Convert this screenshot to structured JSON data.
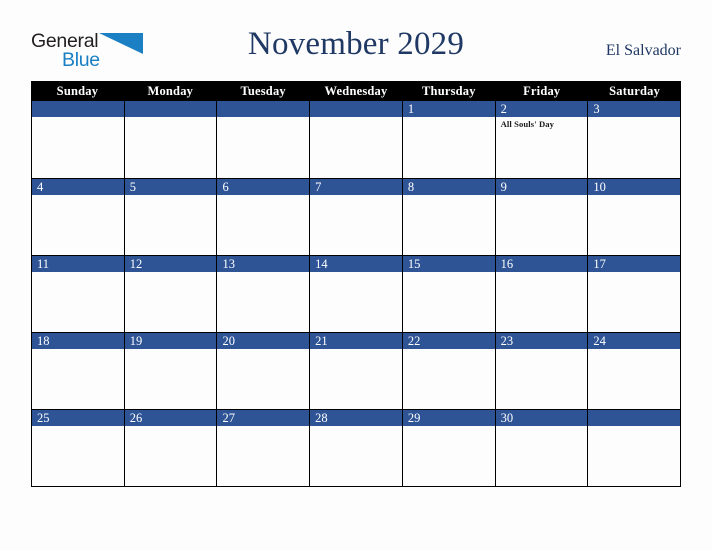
{
  "brand": {
    "name_part1": "General",
    "name_part2": "Blue",
    "triangle_color": "#1b7fc4",
    "text_color": "#231f20"
  },
  "header": {
    "title": "November 2029",
    "region": "El Salvador",
    "title_color": "#1f3864"
  },
  "calendar": {
    "month": "November",
    "year": "2029",
    "accent_color": "#2e5496",
    "header_bg": "#000000",
    "weekday_headers": [
      "Sunday",
      "Monday",
      "Tuesday",
      "Wednesday",
      "Thursday",
      "Friday",
      "Saturday"
    ],
    "weeks": [
      [
        {
          "date": "",
          "events": []
        },
        {
          "date": "",
          "events": []
        },
        {
          "date": "",
          "events": []
        },
        {
          "date": "",
          "events": []
        },
        {
          "date": "1",
          "events": []
        },
        {
          "date": "2",
          "events": [
            "All Souls' Day"
          ]
        },
        {
          "date": "3",
          "events": []
        }
      ],
      [
        {
          "date": "4",
          "events": []
        },
        {
          "date": "5",
          "events": []
        },
        {
          "date": "6",
          "events": []
        },
        {
          "date": "7",
          "events": []
        },
        {
          "date": "8",
          "events": []
        },
        {
          "date": "9",
          "events": []
        },
        {
          "date": "10",
          "events": []
        }
      ],
      [
        {
          "date": "11",
          "events": []
        },
        {
          "date": "12",
          "events": []
        },
        {
          "date": "13",
          "events": []
        },
        {
          "date": "14",
          "events": []
        },
        {
          "date": "15",
          "events": []
        },
        {
          "date": "16",
          "events": []
        },
        {
          "date": "17",
          "events": []
        }
      ],
      [
        {
          "date": "18",
          "events": []
        },
        {
          "date": "19",
          "events": []
        },
        {
          "date": "20",
          "events": []
        },
        {
          "date": "21",
          "events": []
        },
        {
          "date": "22",
          "events": []
        },
        {
          "date": "23",
          "events": []
        },
        {
          "date": "24",
          "events": []
        }
      ],
      [
        {
          "date": "25",
          "events": []
        },
        {
          "date": "26",
          "events": []
        },
        {
          "date": "27",
          "events": []
        },
        {
          "date": "28",
          "events": []
        },
        {
          "date": "29",
          "events": []
        },
        {
          "date": "30",
          "events": []
        },
        {
          "date": "",
          "events": []
        }
      ]
    ]
  }
}
